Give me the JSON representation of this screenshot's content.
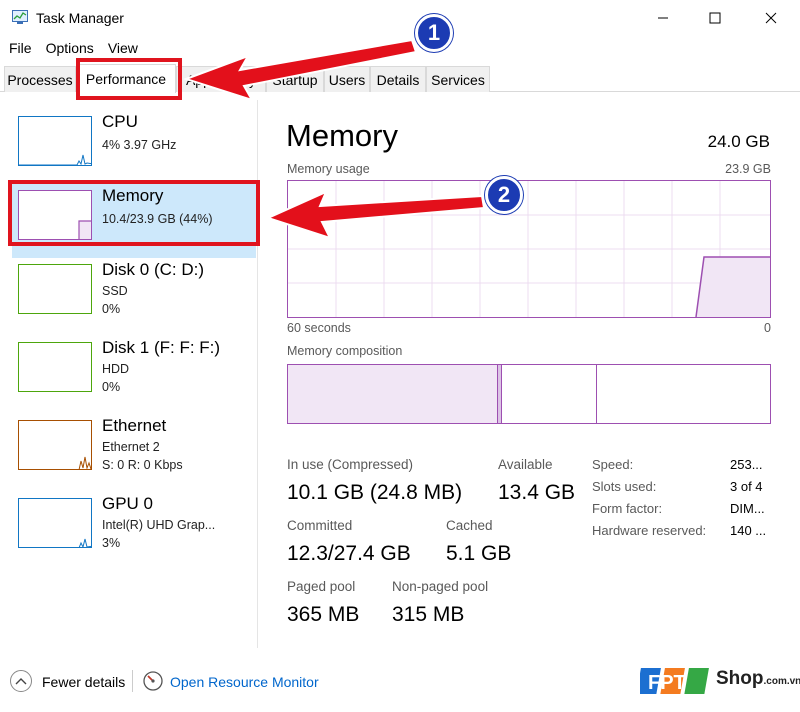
{
  "window": {
    "title": "Task Manager",
    "controls": {
      "minimize": "minimize-icon",
      "maximize": "maximize-icon",
      "close": "close-icon"
    }
  },
  "menu": {
    "file": "File",
    "options": "Options",
    "view": "View"
  },
  "tabs": [
    {
      "label": "Processes"
    },
    {
      "label": "Performance"
    },
    {
      "label": "App history"
    },
    {
      "label": "Startup"
    },
    {
      "label": "Users"
    },
    {
      "label": "Details"
    },
    {
      "label": "Services"
    }
  ],
  "resources": [
    {
      "name": "CPU",
      "line1": "4%  3.97 GHz",
      "line2": "",
      "color": "#1176c4"
    },
    {
      "name": "Memory",
      "line1": "10.4/23.9 GB (44%)",
      "line2": "",
      "color": "#9d4fb1"
    },
    {
      "name": "Disk 0 (C: D:)",
      "line1": "SSD",
      "line2": "0%",
      "color": "#4da60c"
    },
    {
      "name": "Disk 1 (F: F: F:)",
      "line1": "HDD",
      "line2": "0%",
      "color": "#4da60c"
    },
    {
      "name": "Ethernet",
      "line1": "Ethernet 2",
      "line2": "S: 0  R: 0 Kbps",
      "color": "#a74f01"
    },
    {
      "name": "GPU 0",
      "line1": "Intel(R) UHD Grap...",
      "line2": "3%",
      "color": "#1176c4"
    }
  ],
  "memory": {
    "title": "Memory",
    "total": "24.0 GB",
    "usage_label": "Memory usage",
    "usage_max": "23.9 GB",
    "time_left": "60 seconds",
    "time_right": "0",
    "composition_label": "Memory composition",
    "stats": {
      "in_use_label": "In use (Compressed)",
      "in_use_value": "10.1 GB (24.8 MB)",
      "available_label": "Available",
      "available_value": "13.4 GB",
      "committed_label": "Committed",
      "committed_value": "12.3/27.4 GB",
      "cached_label": "Cached",
      "cached_value": "5.1 GB",
      "paged_label": "Paged pool",
      "paged_value": "365 MB",
      "nonpaged_label": "Non-paged pool",
      "nonpaged_value": "315 MB"
    },
    "details": {
      "speed_label": "Speed:",
      "speed_value": "253...",
      "slots_label": "Slots used:",
      "slots_value": "3 of 4",
      "form_label": "Form factor:",
      "form_value": "DIM...",
      "hw_label": "Hardware reserved:",
      "hw_value": "140 ..."
    }
  },
  "footer": {
    "fewer_details": "Fewer details",
    "open_resource_monitor": "Open Resource Monitor"
  },
  "brand": {
    "logo": "FPT",
    "name": "Shop",
    "suffix": ".com.vn"
  },
  "annotations": {
    "badge1": "1",
    "badge2": "2"
  },
  "colors": {
    "highlight": "#e0141e",
    "badge": "#1c3bb3",
    "memory": "#9d4fb1"
  }
}
